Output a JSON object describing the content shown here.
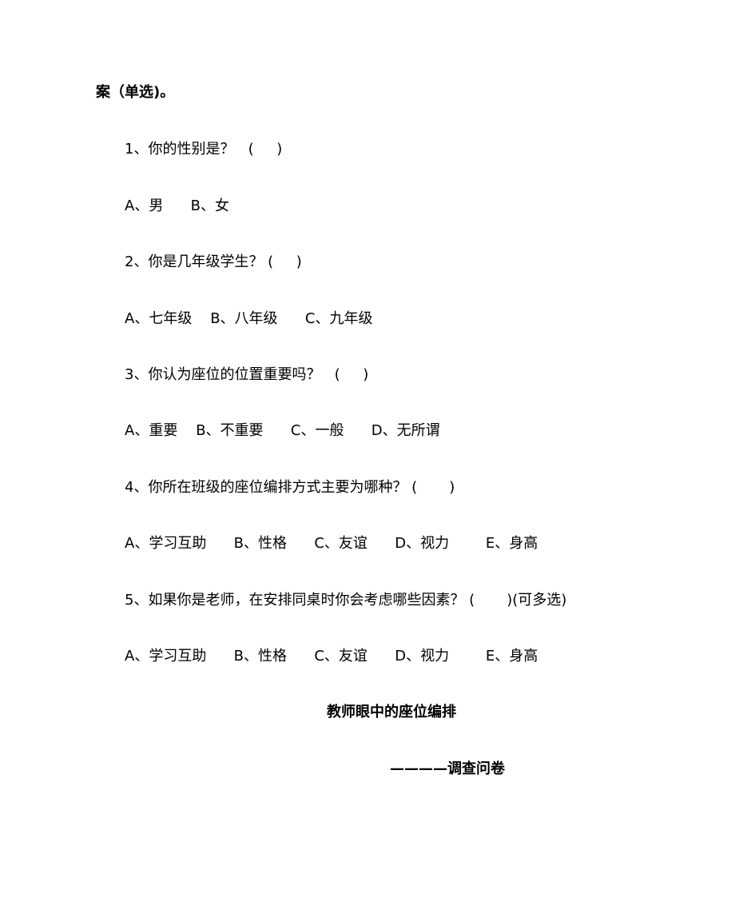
{
  "heading_fragment": "案（单选)。",
  "questions": [
    {
      "q": "1、你的性别是？   (     )",
      "options": "A、男      B、女"
    },
    {
      "q": "2、你是几年级学生？ (     )",
      "options": "A、七年级    B、八年级      C、九年级"
    },
    {
      "q": "3、你认为座位的位置重要吗？   (     )",
      "options": "A、重要    B、不重要      C、一般      D、无所谓"
    },
    {
      "q": "4、你所在班级的座位编排方式主要为哪种？ (       )",
      "options": "A、学习互助      B、性格      C、友谊      D、视力        E、身高"
    },
    {
      "q": "5、如果你是老师，在安排同桌时你会考虑哪些因素？ (       )(可多选)",
      "options": "A、学习互助      B、性格      C、友谊      D、视力        E、身高"
    }
  ],
  "section_title": "教师眼中的座位编排",
  "section_subtitle": "————调查问卷"
}
